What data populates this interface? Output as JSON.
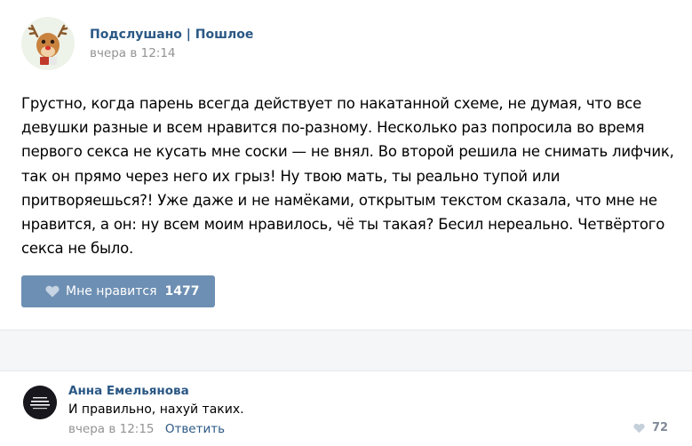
{
  "post": {
    "author": "Подслушано | Пошлое",
    "time": "вчера в 12:14",
    "text": "Грустно, когда парень всегда действует по накатанной схеме, не думая, что все девушки разные и всем нравится по-разному. Несколько раз попросила во время первого секса не кусать мне соски — не внял. Во второй решила не снимать лифчик, так он прямо через него их грыз! Ну твою мать, ты реально тупой или притворяешься?! Уже даже и не намёками, открытым текстом сказала, что мне не нравится, а он: ну всем моим нравилось, чё ты такая? Бесил нереально. Четвёртого секса не было.",
    "like_label": "Мне нравится",
    "like_count": "1477"
  },
  "comment": {
    "author": "Анна Емельянова",
    "text": "И правильно, нахуй таких.",
    "time": "вчера в 12:15",
    "reply_label": "Ответить",
    "like_count": "72"
  },
  "colors": {
    "link": "#2a5885",
    "muted": "#939393",
    "like_button": "#6d8fb3",
    "separator": "#f5f6f8"
  },
  "icons": {
    "post_avatar": "reindeer-avatar-icon",
    "like": "heart-icon",
    "comment_avatar": "dark-avatar-icon"
  }
}
